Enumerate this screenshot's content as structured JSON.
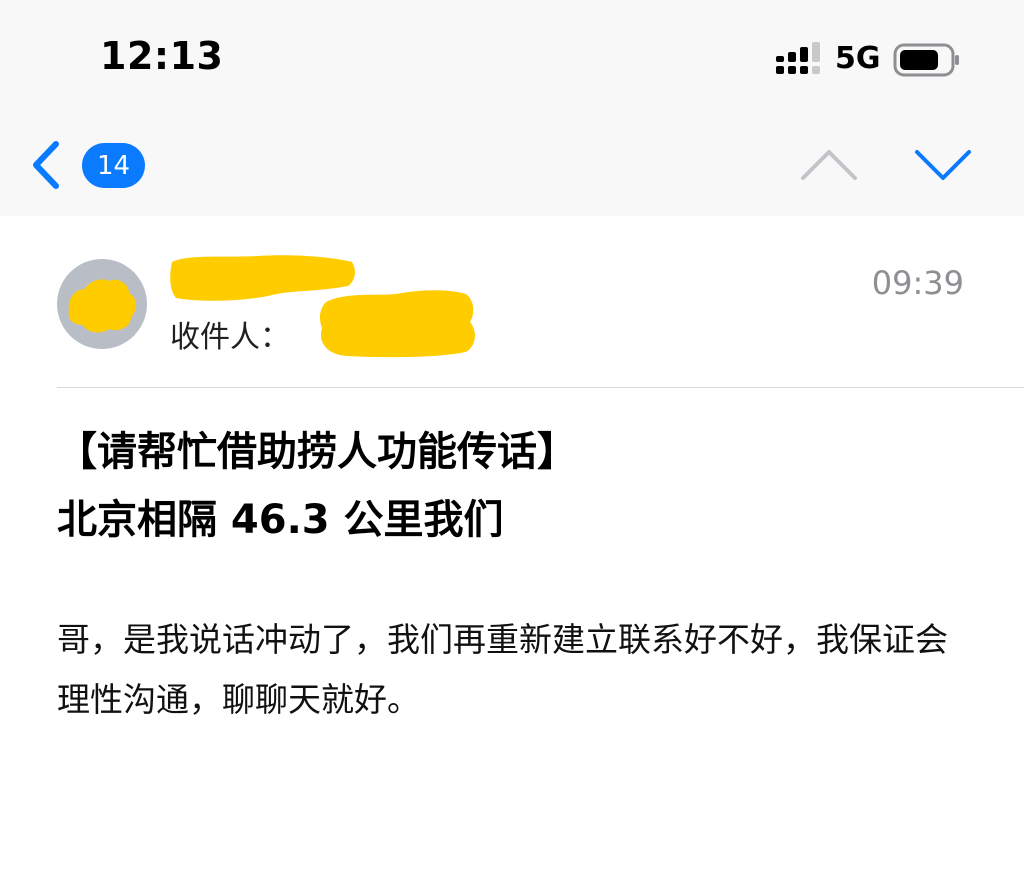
{
  "status_bar": {
    "time": "12:13",
    "network": "5G",
    "signal_icon": "cellular-signal-icon",
    "battery_icon": "battery-icon"
  },
  "nav": {
    "back_icon": "chevron-left-icon",
    "unread_count": "14",
    "prev_icon": "chevron-up-icon",
    "next_icon": "chevron-down-icon",
    "accent_color": "#0a7aff"
  },
  "message": {
    "recipient_label": "收件人：",
    "time": "09:39",
    "subject_line1": "【请帮忙借助捞人功能传话】",
    "subject_line2": "北京相隔 46.3 公里我们",
    "body": "哥，是我说话冲动了，我们再重新建立联系好不好，我保证会理性沟通，聊聊天就好。"
  },
  "redaction_color": "#ffcc00"
}
